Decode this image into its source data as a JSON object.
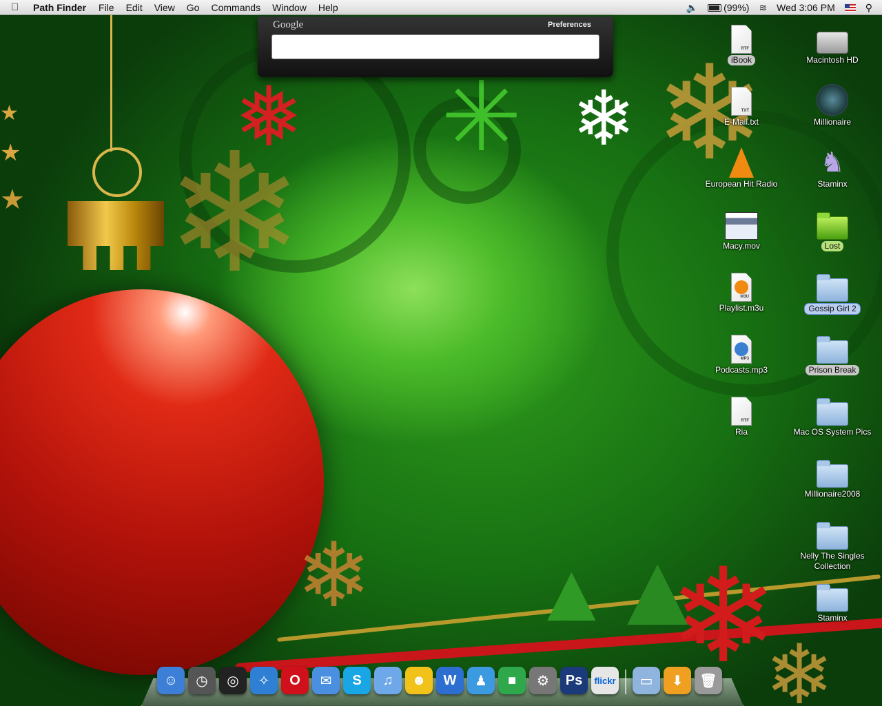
{
  "menubar": {
    "apple_glyph": "",
    "app_name": "Path Finder",
    "menus": [
      "File",
      "Edit",
      "View",
      "Go",
      "Commands",
      "Window",
      "Help"
    ],
    "battery_text": "(99%)",
    "clock": "Wed 3:06 PM"
  },
  "google_widget": {
    "logo": "Google",
    "preferences": "Preferences",
    "search_value": ""
  },
  "desktop_icons": [
    {
      "label": "iBook",
      "kind": "doc",
      "tag": "RTF",
      "label_style": "tag"
    },
    {
      "label": "Macintosh HD",
      "kind": "hd"
    },
    {
      "label": "E-Mail.txt",
      "kind": "doc",
      "tag": "TXT"
    },
    {
      "label": "Millionaire",
      "kind": "globe"
    },
    {
      "label": "European Hit Radio",
      "kind": "cone"
    },
    {
      "label": "Staminx",
      "kind": "figure"
    },
    {
      "label": "Macy.mov",
      "kind": "thumb"
    },
    {
      "label": "Lost",
      "kind": "folder-green",
      "label_style": "tag-green"
    },
    {
      "label": "Playlist.m3u",
      "kind": "doc",
      "tag": "M3U"
    },
    {
      "label": "Gossip Girl 2",
      "kind": "folder",
      "label_style": "tag-blue"
    },
    {
      "label": "Podcasts.mp3",
      "kind": "doc",
      "tag": "MP3"
    },
    {
      "label": "Prison Break",
      "kind": "folder",
      "label_style": "tag"
    },
    {
      "label": "Ria",
      "kind": "doc",
      "tag": "RTF"
    },
    {
      "label": "Mac OS System Pics",
      "kind": "folder"
    },
    {
      "label": "Millionaire2008",
      "kind": "folder"
    },
    {
      "label": "Nelly The Singles Collection",
      "kind": "folder"
    },
    {
      "label": "Staminx",
      "kind": "folder"
    }
  ],
  "dock": {
    "items": [
      {
        "name": "finder",
        "glyph": "☺",
        "color": "#3d7fd6"
      },
      {
        "name": "clock",
        "glyph": "◷",
        "color": "#555"
      },
      {
        "name": "dashboard",
        "glyph": "◎",
        "color": "#222"
      },
      {
        "name": "safari",
        "glyph": "✧",
        "color": "#2f7fd4"
      },
      {
        "name": "opera",
        "glyph": "O",
        "color": "#d0101a"
      },
      {
        "name": "ichat",
        "glyph": "✉",
        "color": "#4a8fe0"
      },
      {
        "name": "skype",
        "glyph": "S",
        "color": "#18a7e4"
      },
      {
        "name": "itunes",
        "glyph": "♫",
        "color": "#6fa8e8"
      },
      {
        "name": "yahoo-messenger",
        "glyph": "☻",
        "color": "#f0c21a"
      },
      {
        "name": "word",
        "glyph": "W",
        "color": "#2d6fd0"
      },
      {
        "name": "messenger",
        "glyph": "♟",
        "color": "#3b9ae0"
      },
      {
        "name": "cube",
        "glyph": "■",
        "color": "#2ea84a"
      },
      {
        "name": "system-preferences",
        "glyph": "⚙",
        "color": "#777"
      },
      {
        "name": "photoshop",
        "glyph": "Ps",
        "color": "#1b3a7a"
      },
      {
        "name": "flickr-uploader",
        "glyph": "flickr",
        "color": "#e6e6e6"
      },
      {
        "name": "documents-folder",
        "glyph": "▭",
        "color": "#8fb4dd"
      },
      {
        "name": "downloads",
        "glyph": "⬇",
        "color": "#f0a020"
      },
      {
        "name": "trash",
        "glyph": "🗑",
        "color": "#9a9a9a"
      }
    ]
  }
}
